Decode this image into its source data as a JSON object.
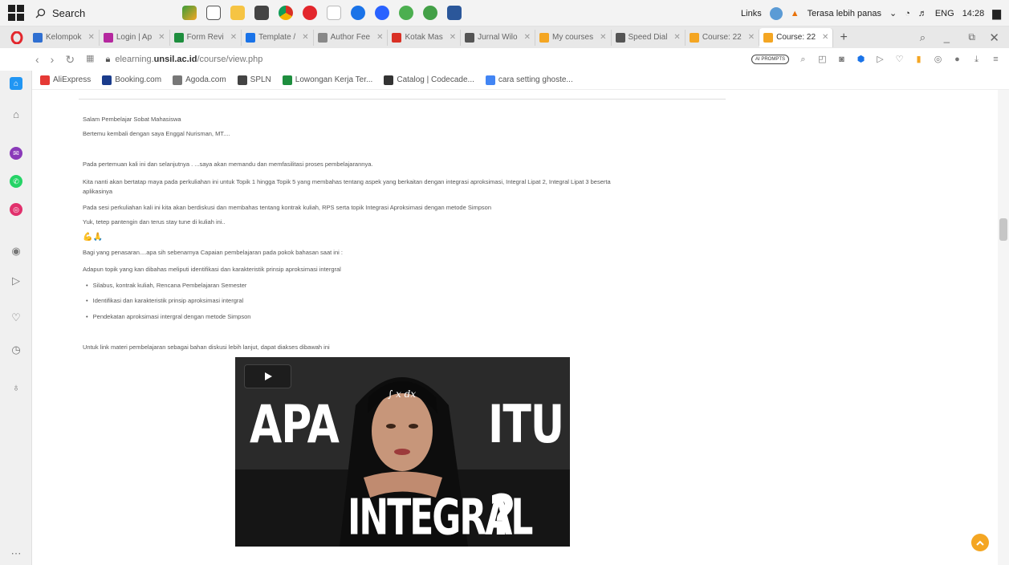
{
  "taskbar": {
    "search_label": "Search",
    "links_label": "Links",
    "weather_label": "Terasa lebih panas",
    "lang": "ENG",
    "time": "14:28"
  },
  "tabs": [
    {
      "label": "Kelompok",
      "color": "#2f6fd1"
    },
    {
      "label": "Login | Ap",
      "color": "#b5289f"
    },
    {
      "label": "Form Revi",
      "color": "#1e8e3e"
    },
    {
      "label": "Template /",
      "color": "#1a73e8"
    },
    {
      "label": "Author Fee",
      "color": "#888888"
    },
    {
      "label": "Kotak Mas",
      "color": "#d93025"
    },
    {
      "label": "Jurnal Wilo",
      "color": "#555555"
    },
    {
      "label": "My courses",
      "color": "#f4a623"
    },
    {
      "label": "Speed Dial",
      "color": "#555555"
    },
    {
      "label": "Course: 22",
      "color": "#f4a623"
    },
    {
      "label": "Course: 22",
      "color": "#f4a623"
    }
  ],
  "address": {
    "prefix": "elearning.",
    "domain": "unsil.ac.id",
    "path": "/course/view.php",
    "pill": "AI PROMPTS"
  },
  "bookmarks": [
    {
      "label": "AliExpress",
      "color": "#e53935"
    },
    {
      "label": "Booking.com",
      "color": "#1a3c8c"
    },
    {
      "label": "Agoda.com",
      "color": "#777777"
    },
    {
      "label": "SPLN",
      "color": "#444444"
    },
    {
      "label": "Lowongan Kerja Ter...",
      "color": "#1e8e3e"
    },
    {
      "label": "Catalog | Codecade...",
      "color": "#333333"
    },
    {
      "label": "cara setting ghoste...",
      "color": "#4285f4"
    }
  ],
  "course": {
    "greeting": "Salam Pembelajar Sobat Mahasiswa",
    "intro": "Bertemu kembali dengan saya Enggal Nurisman, MT....",
    "p1": "Pada pertemuan kali ini dan  selanjutnya . ...saya akan memandu dan memfasilitasi proses pembelajarannya.",
    "p2a": "Kita nanti akan bertatap maya pada perkuliahan ini untuk Topik 1 hingga Topik 5 yang membahas tentang aspek yang berkaitan dengan integrasi aproksimasi, Integral Lipat 2, Integral Lipat 3 beserta",
    "p2b": "aplikasinya",
    "p3": "Pada sesi  perkuliahan  kali ini kita akan berdiskusi dan membahas tentang kontrak kuliah, RPS serta topik Integrasi Aproksimasi dengan metode Simpson",
    "p4": "Yuk, tetep pantengin dan terus stay tune di kuliah ini..",
    "emoji": "💪🙏",
    "p5": "Bagi yang penasaran....apa sih sebenarnya Capaian pembelajaran pada pokok bahasan saat ini :",
    "p6": "Adapun topik yang kan dibahas meliputi identifikasi dan karakteristik prinsip aproksimasi intergral",
    "bullets": [
      "Silabus, kontrak kuliah, Rencana Pembelajaran Semester",
      "Identifikasi dan karakteristik prinsip aproksimasi intergral",
      "Pendekatan aproksimasi intergral dengan metode Simpson"
    ],
    "p7": "Untuk link materi pembelajaran sebagai bahan diskusi lebih lanjut, dapat diakses dibawah ini"
  },
  "video": {
    "word1": "APA",
    "word2": "ITU",
    "word3": "INTEGRAL",
    "qmark": "?",
    "formula": "∫ x dx"
  }
}
